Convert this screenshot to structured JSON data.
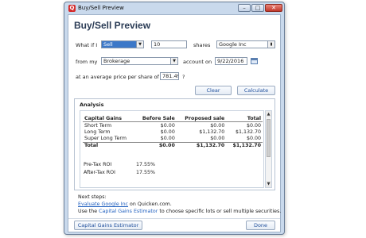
{
  "window": {
    "title": "Buy/Sell Preview",
    "app_icon": "quicken-q-icon"
  },
  "heading": "Buy/Sell Preview",
  "form": {
    "what_if_label": "What if I",
    "action_value": "Sell",
    "quantity_value": "10",
    "shares_label": "shares",
    "security_value": "Google Inc",
    "from_my_label": "from my",
    "account_value": "Brokerage",
    "account_on_label": "account on",
    "date_value": "9/22/2016",
    "price_label": "at an average price per share of $",
    "price_value": "781.49",
    "price_suffix": "?"
  },
  "buttons": {
    "clear": "Clear",
    "calculate": "Calculate",
    "cg_estimator": "Capital Gains Estimator",
    "done": "Done"
  },
  "analysis": {
    "title": "Analysis",
    "columns": [
      "Capital Gains",
      "Before Sale",
      "Proposed sale",
      "Total"
    ],
    "rows": [
      [
        "Short Term",
        "$0.00",
        "$0.00",
        "$0.00"
      ],
      [
        "Long Term",
        "$0.00",
        "$1,132.70",
        "$1,132.70"
      ],
      [
        "Super Long Term",
        "$0.00",
        "$0.00",
        "$0.00"
      ]
    ],
    "total_row": [
      "Total",
      "$0.00",
      "$1,132.70",
      "$1,132.70"
    ],
    "pretax_label": "Pre-Tax ROI",
    "pretax_value": "17.55%",
    "aftertax_label": "After-Tax ROI",
    "aftertax_value": "17.55%"
  },
  "next_steps": {
    "heading": "Next steps:",
    "line1_link": "Evaluate Google Inc",
    "line1_rest": " on Quicken.com.",
    "line2_prefix": "Use the ",
    "line2_link": "Capital Gains Estimator",
    "line2_rest": " to choose specific lots or sell multiple securities."
  }
}
